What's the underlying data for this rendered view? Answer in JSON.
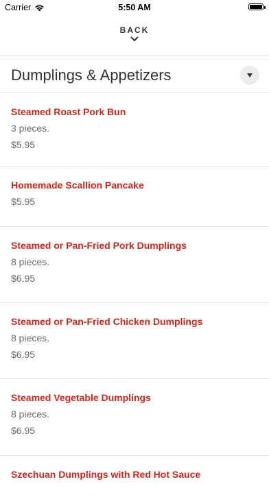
{
  "status_bar": {
    "carrier": "Carrier",
    "time": "5:50 AM"
  },
  "nav": {
    "back_label": "BACK"
  },
  "section": {
    "title": "Dumplings & Appetizers"
  },
  "colors": {
    "accent_red": "#c8281e",
    "text_gray": "#6b6b6b",
    "divider": "#e6e6e6"
  },
  "items": [
    {
      "name": "Steamed Roast Pork Bun",
      "description": "3 pieces.",
      "price": "$5.95"
    },
    {
      "name": "Homemade Scallion Pancake",
      "description": "",
      "price": "$5.95"
    },
    {
      "name": "Steamed or Pan-Fried Pork Dumplings",
      "description": "8 pieces.",
      "price": "$6.95"
    },
    {
      "name": "Steamed or Pan-Fried Chicken Dumplings",
      "description": "8 pieces.",
      "price": "$6.95"
    },
    {
      "name": "Steamed Vegetable Dumplings",
      "description": "8 pieces.",
      "price": "$6.95"
    },
    {
      "name": "Szechuan Dumplings with Red Hot Sauce",
      "description": "",
      "price": ""
    }
  ]
}
